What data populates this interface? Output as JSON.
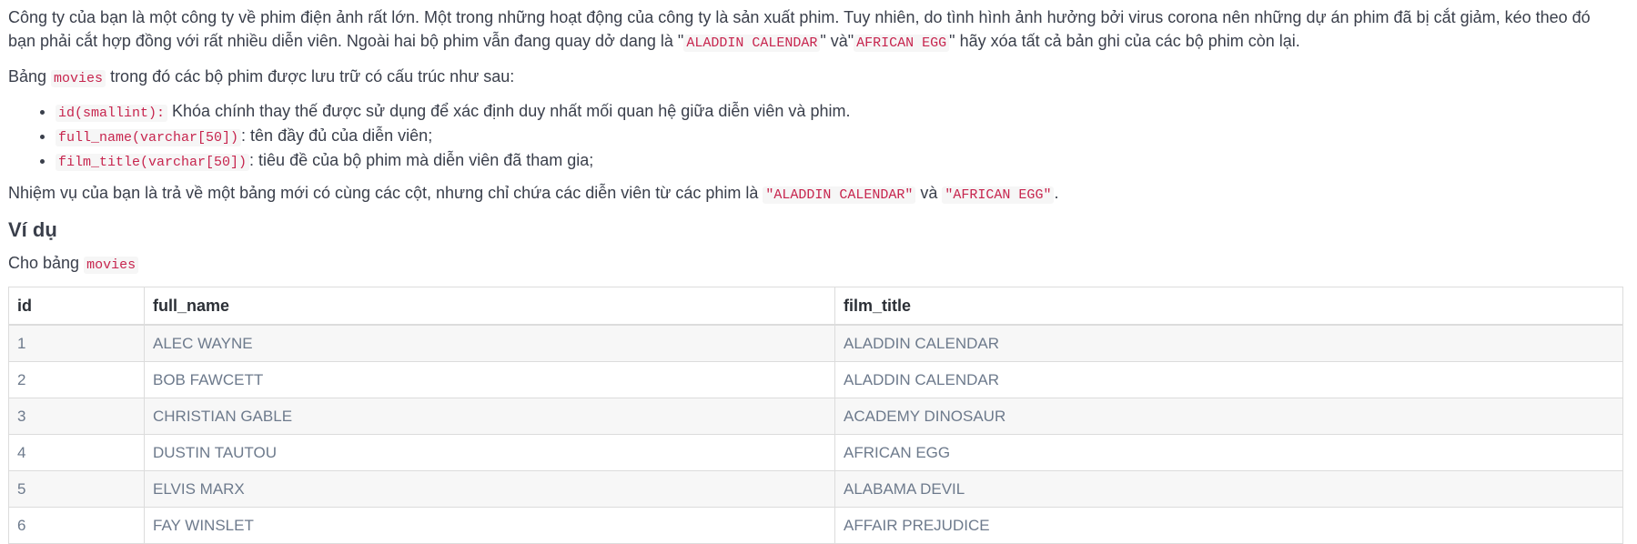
{
  "intro": {
    "part1": "Công ty của bạn là một công ty về phim điện ảnh rất lớn. Một trong những hoạt động của công ty là sản xuất phim. Tuy nhiên, do tình hình ảnh hưởng bởi virus corona nên những dự án phim đã bị cắt giảm, kéo theo đó bạn phải cắt hợp đồng với rất nhiều diễn viên. Ngoài hai bộ phim vẫn đang quay dở dang là \"",
    "film1": "ALADDIN CALENDAR",
    "part2": "\" và\"",
    "film2": "AFRICAN EGG",
    "part3": "\" hãy xóa tất cả bản ghi của các bộ phim còn lại."
  },
  "structure": {
    "prefix": "Bảng ",
    "table_name": "movies",
    "suffix": " trong đó các bộ phim được lưu trữ có cấu trúc như sau:"
  },
  "fields": [
    {
      "code": "id(smallint):",
      "desc": " Khóa chính thay thế được sử dụng để xác định duy nhất mối quan hệ giữa diễn viên và phim."
    },
    {
      "code": "full_name(varchar[50])",
      "desc": ": tên đầy đủ của diễn viên;"
    },
    {
      "code": "film_title(varchar[50])",
      "desc": ": tiêu đề của bộ phim mà diễn viên đã tham gia;"
    }
  ],
  "task": {
    "prefix": "Nhiệm vụ của bạn là trả về một bảng mới có cùng các cột, nhưng chỉ chứa các diễn viên từ các phim là ",
    "film1": "\"ALADDIN CALENDAR\"",
    "middle": " và ",
    "film2": "\"AFRICAN EGG\"",
    "suffix": "."
  },
  "example": {
    "heading": "Ví dụ",
    "given_prefix": "Cho bảng ",
    "given_table": "movies"
  },
  "table": {
    "headers": [
      "id",
      "full_name",
      "film_title"
    ],
    "rows": [
      [
        "1",
        "ALEC WAYNE",
        "ALADDIN CALENDAR"
      ],
      [
        "2",
        "BOB FAWCETT",
        "ALADDIN CALENDAR"
      ],
      [
        "3",
        "CHRISTIAN GABLE",
        "ACADEMY DINOSAUR"
      ],
      [
        "4",
        "DUSTIN TAUTOU",
        "AFRICAN EGG"
      ],
      [
        "5",
        "ELVIS MARX",
        "ALABAMA DEVIL"
      ],
      [
        "6",
        "FAY WINSLET",
        "AFFAIR PREJUDICE"
      ]
    ]
  }
}
